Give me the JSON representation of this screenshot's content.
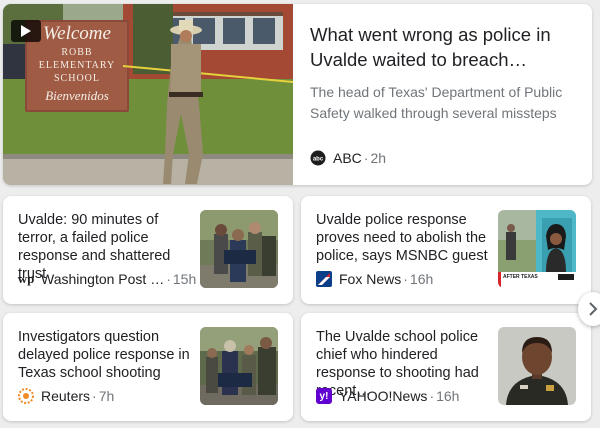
{
  "featured": {
    "title": "What went wrong as police in Uvalde waited to breach…",
    "snippet": "The head of Texas' Department of Public Safety walked through several missteps in…",
    "source": "ABC",
    "time": "2h",
    "source_icon": "abc-news-logo",
    "image": {
      "sign_lines": [
        "Welcome",
        "ROBB",
        "ELEMENTARY",
        "SCHOOL",
        "Bienvenidos"
      ],
      "play_icon": "play-icon"
    }
  },
  "articles": [
    {
      "title": "Uvalde: 90 minutes of terror, a failed police response and shattered trust",
      "source": "Washington Post …",
      "time": "15h",
      "source_icon": "washington-post-logo",
      "logo_text": "wp"
    },
    {
      "title": "Uvalde police response proves need to abolish the police, says MSNBC guest",
      "source": "Fox News",
      "time": "16h",
      "source_icon": "fox-news-logo",
      "logo_text": "",
      "thumb_caption": "AFTER TEXAS"
    },
    {
      "title": "Investigators question delayed police response in Texas school shooting",
      "source": "Reuters",
      "time": "7h",
      "source_icon": "reuters-logo",
      "logo_text": ""
    },
    {
      "title": "The Uvalde school police chief who hindered response to shooting had recent…",
      "source": "YAHOO!News",
      "time": "16h",
      "source_icon": "yahoo-news-logo",
      "logo_text": "y!"
    }
  ],
  "dot": "·",
  "next_icon": "chevron-right-icon",
  "colors": {
    "title": "#202124",
    "snippet": "#70757a",
    "background": "#ededed",
    "fox_blue": "#0b3f8a",
    "yahoo_purple": "#6001d2",
    "reuters_orange": "#f08a24"
  }
}
